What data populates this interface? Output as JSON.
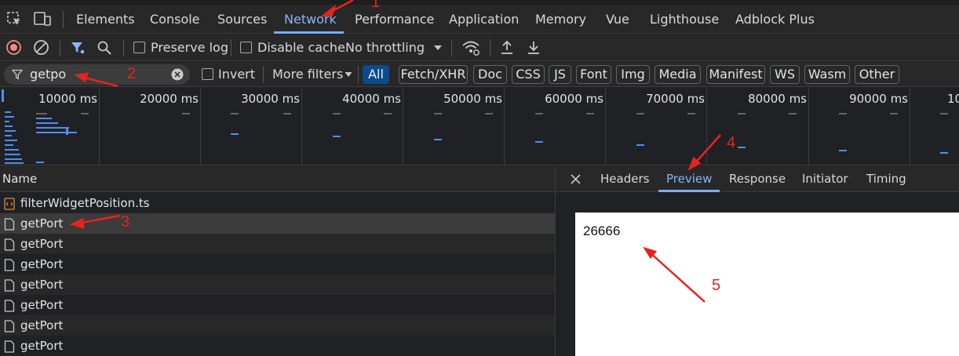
{
  "tabs": [
    "Elements",
    "Console",
    "Sources",
    "Network",
    "Performance",
    "Application",
    "Memory",
    "Vue",
    "Lighthouse",
    "Adblock Plus"
  ],
  "active_tab": "Network",
  "toolbar": {
    "preserve_log": "Preserve log",
    "disable_cache": "Disable cache",
    "throttling": "No throttling"
  },
  "filter": {
    "value": "getpo",
    "invert": "Invert",
    "more_filters": "More filters",
    "types": [
      "All",
      "Fetch/XHR",
      "Doc",
      "CSS",
      "JS",
      "Font",
      "Img",
      "Media",
      "Manifest",
      "WS",
      "Wasm",
      "Other"
    ],
    "active_type": "All"
  },
  "timeline": {
    "ticks": [
      "10000 ms",
      "20000 ms",
      "30000 ms",
      "40000 ms",
      "50000 ms",
      "60000 ms",
      "70000 ms",
      "80000 ms",
      "90000 ms",
      "10"
    ]
  },
  "requests": {
    "header": "Name",
    "rows": [
      "filterWidgetPosition.ts",
      "getPort",
      "getPort",
      "getPort",
      "getPort",
      "getPort",
      "getPort",
      "getPort"
    ]
  },
  "detail": {
    "tabs": [
      "Headers",
      "Preview",
      "Response",
      "Initiator",
      "Timing"
    ],
    "active_tab": "Preview",
    "preview_value": "26666"
  },
  "annotations": [
    "1",
    "2",
    "3",
    "4",
    "5"
  ],
  "colors": {
    "accent": "#8ab4f8",
    "annotation": "#e8231f",
    "record": "#f28b82",
    "filter_active": "#8ab4f8"
  }
}
